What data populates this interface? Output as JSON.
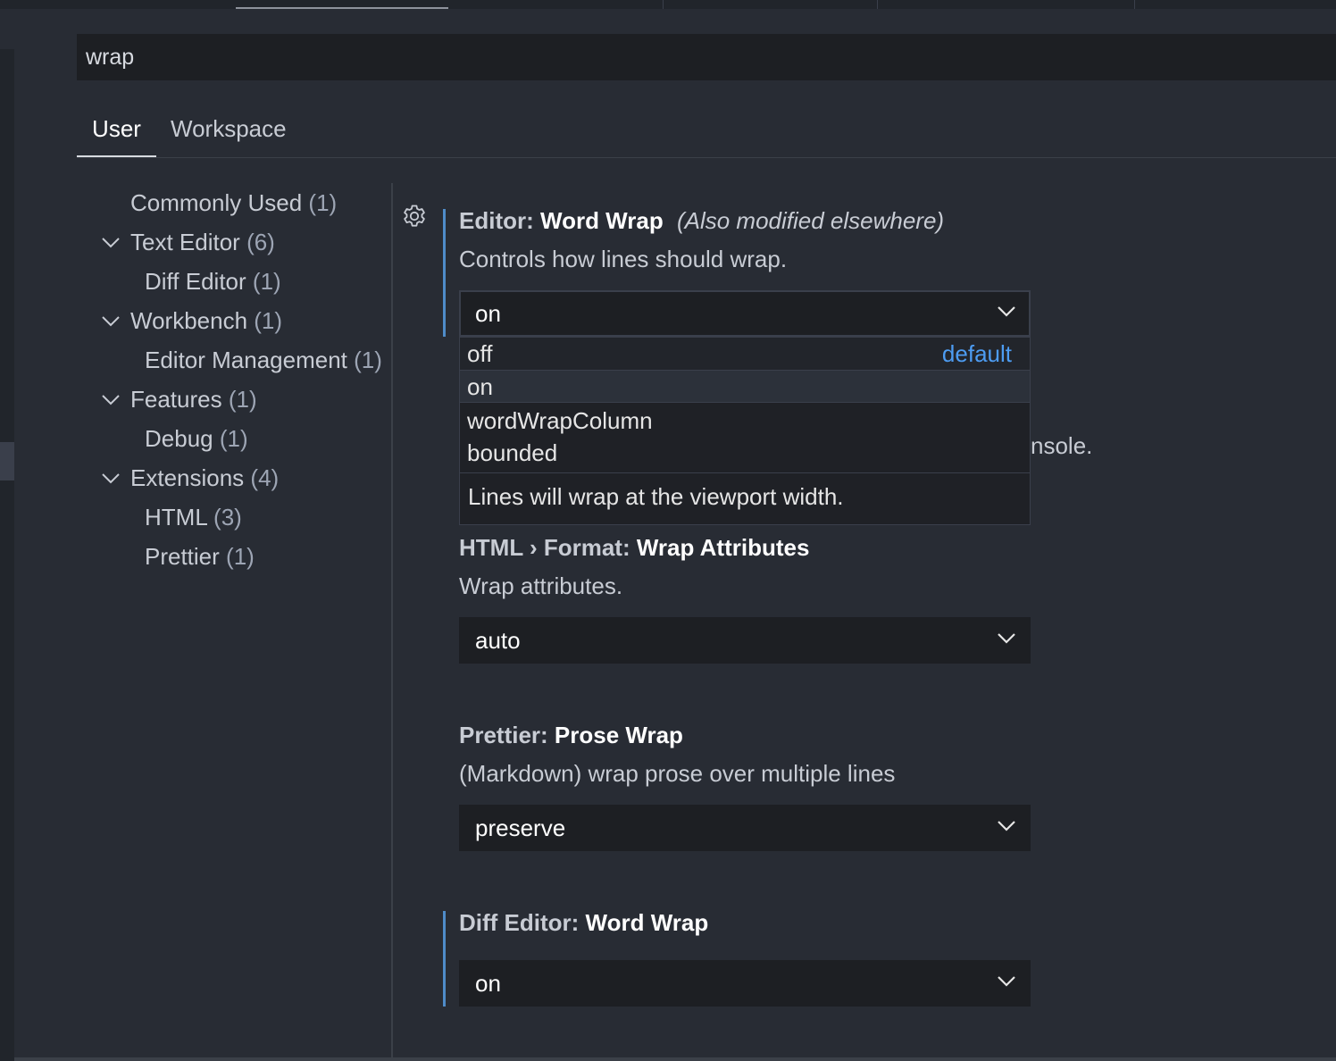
{
  "search": {
    "value": "wrap"
  },
  "tabs": [
    {
      "label": "User",
      "active": true
    },
    {
      "label": "Workspace",
      "active": false
    }
  ],
  "toc": [
    {
      "label": "Commonly Used",
      "count": "(1)",
      "expandable": false
    },
    {
      "label": "Text Editor",
      "count": "(6)",
      "expandable": true,
      "expanded": true
    },
    {
      "label": "Diff Editor",
      "count": "(1)",
      "expandable": false
    },
    {
      "label": "Workbench",
      "count": "(1)",
      "expandable": true,
      "expanded": true
    },
    {
      "label": "Editor Management",
      "count": "(1)",
      "expandable": false
    },
    {
      "label": "Features",
      "count": "(1)",
      "expandable": true,
      "expanded": true
    },
    {
      "label": "Debug",
      "count": "(1)",
      "expandable": false
    },
    {
      "label": "Extensions",
      "count": "(4)",
      "expandable": true,
      "expanded": true
    },
    {
      "label": "HTML",
      "count": "(3)",
      "expandable": false
    },
    {
      "label": "Prettier",
      "count": "(1)",
      "expandable": false
    }
  ],
  "settings": {
    "word_wrap": {
      "category": "Editor: ",
      "name": "Word Wrap",
      "note": "(Also modified elsewhere)",
      "description": "Controls how lines should wrap.",
      "value": "on",
      "dropdown": {
        "options": [
          "off",
          "on",
          "wordWrapColumn",
          "bounded"
        ],
        "default_option": "off",
        "default_badge": "default",
        "highlighted": "on",
        "option_description": "Lines will wrap at the viewport width."
      },
      "obscured_peek_text": "nsole."
    },
    "html_wrap_attributes": {
      "category": "HTML › Format: ",
      "name": "Wrap Attributes",
      "description": "Wrap attributes.",
      "value": "auto"
    },
    "prettier_prose_wrap": {
      "category": "Prettier: ",
      "name": "Prose Wrap",
      "description": "(Markdown) wrap prose over multiple lines",
      "value": "preserve"
    },
    "diff_editor_word_wrap": {
      "category": "Diff Editor: ",
      "name": "Word Wrap",
      "value": "on"
    }
  },
  "colors": {
    "background": "#282c34",
    "input_background": "#1d1f23",
    "modified_indicator": "#4f8cc9",
    "default_badge": "#4d9cf2"
  },
  "icons": {
    "gear": "gear-icon",
    "chevron": "chevron-down-icon"
  }
}
